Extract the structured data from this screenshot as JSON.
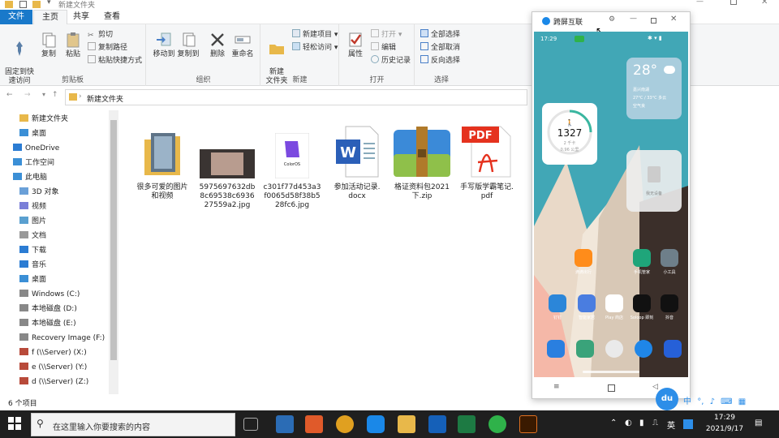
{
  "window": {
    "title": "新建文件夹"
  },
  "menu": {
    "file": "文件",
    "home": "主页",
    "share": "共享",
    "view": "查看"
  },
  "ribbon": {
    "clipboard": {
      "pin": "固定到快\n速访问",
      "copy": "复制",
      "paste": "粘贴",
      "cut": "剪切",
      "copy_path": "复制路径",
      "paste_shortcut": "粘贴快捷方式",
      "label": "剪贴板"
    },
    "organize": {
      "move_to": "移动到",
      "copy_to": "复制到",
      "delete": "删除",
      "rename": "重命名",
      "label": "组织"
    },
    "new": {
      "new_folder": "新建\n文件夹",
      "new_item": "新建项目",
      "easy_access": "轻松访问",
      "label": "新建"
    },
    "open": {
      "properties": "属性",
      "open": "打开",
      "edit": "编辑",
      "history": "历史记录",
      "label": "打开"
    },
    "select": {
      "select_all": "全部选择",
      "select_none": "全部取消",
      "invert": "反向选择",
      "label": "选择"
    }
  },
  "address": {
    "path": "新建文件夹"
  },
  "nav": {
    "items": [
      "新建文件夹",
      "桌面",
      "OneDrive",
      "工作空间",
      "此电脑",
      "3D 对象",
      "视频",
      "图片",
      "文档",
      "下载",
      "音乐",
      "桌面",
      "Windows (C:)",
      "本地磁盘 (D:)",
      "本地磁盘 (E:)",
      "Recovery Image (F:)",
      "f (\\\\Server) (X:)",
      "e (\\\\Server) (Y:)",
      "d (\\\\Server) (Z:)"
    ]
  },
  "files": [
    {
      "name": "很多可爱的图片\n和视频"
    },
    {
      "name": "5975697632db\n8c69538c6936\n27559a2.jpg"
    },
    {
      "name": "c301f77d453a3\nf0065d58f38b5\n28fc6.jpg"
    },
    {
      "name": "参加活动记录.\ndocx"
    },
    {
      "name": "格证资料包2021\n下.zip"
    },
    {
      "name": "手写版学霸笔记.\npdf"
    }
  ],
  "thumb_text": {
    "coloros": "ColorOS",
    "pdf": "PDF"
  },
  "status": {
    "count": "6 个项目"
  },
  "phone": {
    "app_title": "跨屏互联",
    "time": "17:29",
    "weather": {
      "temp": "28°",
      "city": "嘉兴南湖",
      "range": "27°C / 33°C  多云",
      "aqi": "空气良"
    },
    "steps": {
      "count": "1327",
      "goal": "2 千卡",
      "km": "0.96 公里"
    },
    "device": "我无设备",
    "apps": [
      {
        "name": "滴滴出行",
        "color": "#ff8c1a"
      },
      {
        "name": "手机管家",
        "color": "#1fa57a"
      },
      {
        "name": "小工具",
        "color": "#6e7f8a"
      },
      {
        "name": "钉钉",
        "color": "#2b86d9"
      },
      {
        "name": "智能家居",
        "color": "#4a7de0"
      },
      {
        "name": "Play 商店",
        "color": "#ffffff"
      },
      {
        "name": "Soloop 即刻",
        "color": "#111111"
      },
      {
        "name": "抖音",
        "color": "#111111"
      }
    ],
    "dock": [
      {
        "name": "phone",
        "color": "#2a7fe0"
      },
      {
        "name": "messages",
        "color": "#3aa37a"
      },
      {
        "name": "camera",
        "color": "#eaeaea"
      },
      {
        "name": "browser",
        "color": "#1f86e8"
      },
      {
        "name": "gallery",
        "color": "#2660d8"
      }
    ]
  },
  "taskbar": {
    "search_placeholder": "在这里输入你要搜索的内容",
    "time": "17:29",
    "date": "2021/9/17",
    "ime": "英",
    "ime2": "中"
  },
  "colors": {
    "accent": "#1979ca",
    "taskbar": "#1f1f1f",
    "phone_bg": "#41a7b6"
  }
}
